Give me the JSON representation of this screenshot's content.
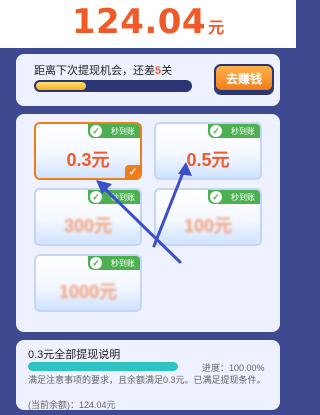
{
  "balance": {
    "amount": "124.04",
    "unit": "元"
  },
  "progress": {
    "text_prefix": "距离下次提现机会，还差",
    "remaining": "5",
    "text_suffix": "关",
    "fraction": 0.34,
    "earn_label": "去赚钱"
  },
  "options": [
    {
      "amount": "0.3元",
      "badge": "秒到账",
      "selected": true
    },
    {
      "amount": "0.5元",
      "badge": "秒到账",
      "selected": false
    },
    {
      "amount": "300元",
      "badge": "秒到账",
      "selected": false
    },
    {
      "amount": "100元",
      "badge": "秒到账",
      "selected": false
    },
    {
      "amount": "1000元",
      "badge": "秒到账",
      "selected": false
    }
  ],
  "info": {
    "title": "0.3元全部提现说明",
    "progress_label": "进度：100.00%",
    "fraction": 1.0,
    "description": "满足注意事项的要求，且余额满足0.3元。已满足提现条件。",
    "current_balance": "(当前余额)：124.04元"
  },
  "colors": {
    "accent": "#f05a28",
    "background": "#3d4a8f",
    "badge": "#4caf50",
    "progress_fill": "#2ec4c4"
  },
  "icons": {
    "badge_check": "check-circle-icon",
    "selected_corner": "checkmark-icon",
    "pointer": "arrow-icon"
  }
}
